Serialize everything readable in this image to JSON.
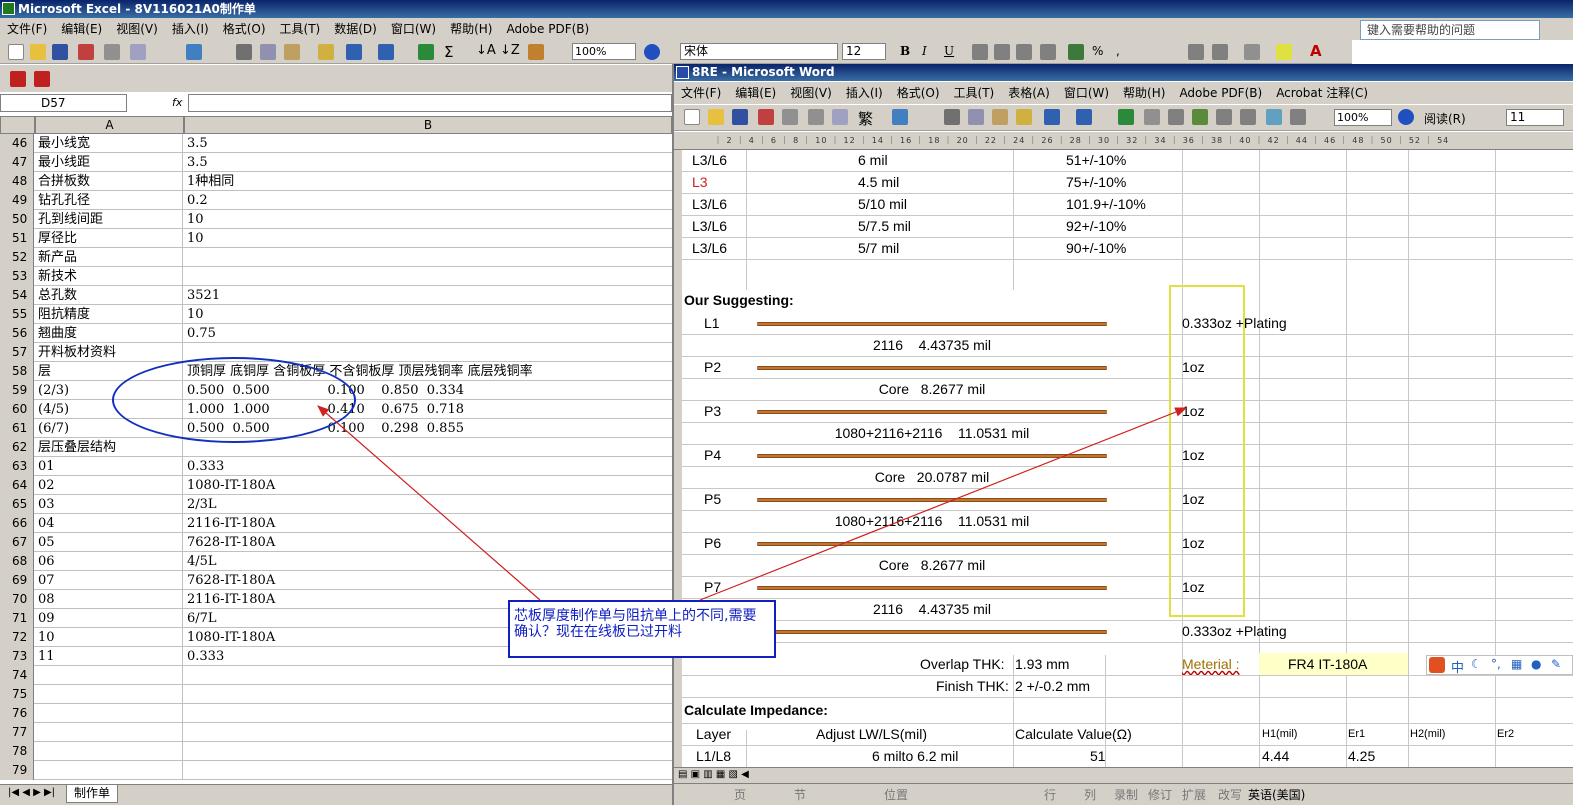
{
  "excel": {
    "title": "Microsoft Excel - 8V116021A0制作单",
    "menu": [
      "文件(F)",
      "编辑(E)",
      "视图(V)",
      "插入(I)",
      "格式(O)",
      "工具(T)",
      "数据(D)",
      "窗口(W)",
      "帮助(H)",
      "Adobe PDF(B)"
    ],
    "zoom": "100%",
    "font_name": "宋体",
    "font_size": "12",
    "help_placeholder": "键入需要帮助的问题",
    "name_box": "D57",
    "fx": "fx",
    "col_a": "A",
    "col_b": "B",
    "rows": [
      {
        "n": "46",
        "a": "最小线宽",
        "b": "3.5"
      },
      {
        "n": "47",
        "a": "最小线距",
        "b": "3.5"
      },
      {
        "n": "48",
        "a": "合拼板数",
        "b": "1种相同"
      },
      {
        "n": "49",
        "a": "钻孔孔径",
        "b": "0.2"
      },
      {
        "n": "50",
        "a": "孔到线间距",
        "b": "10"
      },
      {
        "n": "51",
        "a": "厚径比",
        "b": "10"
      },
      {
        "n": "52",
        "a": "新产品",
        "b": ""
      },
      {
        "n": "53",
        "a": "新技术",
        "b": ""
      },
      {
        "n": "54",
        "a": "总孔数",
        "b": "3521"
      },
      {
        "n": "55",
        "a": "阻抗精度",
        "b": "10"
      },
      {
        "n": "56",
        "a": "翘曲度",
        "b": "0.75"
      },
      {
        "n": "57",
        "a": "开料板材资料",
        "b": ""
      },
      {
        "n": "58",
        "a": "层",
        "b": "顶铜厚 底铜厚 含铜板厚 不含铜板厚 顶层残铜率 底层残铜率"
      },
      {
        "n": "59",
        "a": "(2/3)",
        "b": "0.500  0.500              0.100    0.850  0.334"
      },
      {
        "n": "60",
        "a": "(4/5)",
        "b": "1.000  1.000              0.410    0.675  0.718"
      },
      {
        "n": "61",
        "a": "(6/7)",
        "b": "0.500  0.500              0.100    0.298  0.855"
      },
      {
        "n": "62",
        "a": "层压叠层结构",
        "b": ""
      },
      {
        "n": "63",
        "a": "01",
        "b": "0.333"
      },
      {
        "n": "64",
        "a": "02",
        "b": "1080-IT-180A"
      },
      {
        "n": "65",
        "a": "03",
        "b": "2/3L"
      },
      {
        "n": "66",
        "a": "04",
        "b": "2116-IT-180A"
      },
      {
        "n": "67",
        "a": "05",
        "b": "7628-IT-180A"
      },
      {
        "n": "68",
        "a": "06",
        "b": "4/5L"
      },
      {
        "n": "69",
        "a": "07",
        "b": "7628-IT-180A"
      },
      {
        "n": "70",
        "a": "08",
        "b": "2116-IT-180A"
      },
      {
        "n": "71",
        "a": "09",
        "b": "6/7L"
      },
      {
        "n": "72",
        "a": "10",
        "b": "1080-IT-180A"
      },
      {
        "n": "73",
        "a": "11",
        "b": "0.333"
      },
      {
        "n": "74",
        "a": "",
        "b": ""
      },
      {
        "n": "75",
        "a": "",
        "b": ""
      },
      {
        "n": "76",
        "a": "",
        "b": ""
      },
      {
        "n": "77",
        "a": "",
        "b": ""
      },
      {
        "n": "78",
        "a": "",
        "b": ""
      },
      {
        "n": "79",
        "a": "",
        "b": ""
      }
    ],
    "sheet_tab": "制作单",
    "callout": "芯板厚度制作单与阻抗单上的不同,需要确认？现在在线板已过开料"
  },
  "word": {
    "title": "8RE - Microsoft Word",
    "menu": [
      "文件(F)",
      "编辑(E)",
      "视图(V)",
      "插入(I)",
      "格式(O)",
      "工具(T)",
      "表格(A)",
      "窗口(W)",
      "帮助(H)",
      "Adobe PDF(B)",
      "Acrobat 注释(C)"
    ],
    "zoom": "100%",
    "read_btn": "阅读(R)",
    "font_size": "11",
    "imp_rows": [
      {
        "layer": "L3/L6",
        "width": "6 mil",
        "value": "51+/-10%",
        "red": false
      },
      {
        "layer": "L3",
        "width": "4.5 mil",
        "value": "75+/-10%",
        "red": true
      },
      {
        "layer": "L3/L6",
        "width": "5/10 mil",
        "value": "101.9+/-10%",
        "red": false
      },
      {
        "layer": "L3/L6",
        "width": "5/7.5 mil",
        "value": "92+/-10%",
        "red": false
      },
      {
        "layer": "L3/L6",
        "width": "5/7 mil",
        "value": "90+/-10%",
        "red": false
      }
    ],
    "suggest_title": "Our Suggesting:",
    "stack": [
      {
        "label": "L1",
        "oz": "0.333oz +Plating",
        "copper": true
      },
      {
        "label": "",
        "text": "2116    4.43735 mil"
      },
      {
        "label": "P2",
        "oz": "1oz",
        "copper": true
      },
      {
        "label": "",
        "text": "Core   8.2677 mil"
      },
      {
        "label": "P3",
        "oz": "1oz",
        "copper": true
      },
      {
        "label": "",
        "text": "1080+2116+2116    11.0531 mil"
      },
      {
        "label": "P4",
        "oz": "1oz",
        "copper": true
      },
      {
        "label": "",
        "text": "Core   20.0787 mil"
      },
      {
        "label": "P5",
        "oz": "1oz",
        "copper": true
      },
      {
        "label": "",
        "text": "1080+2116+2116    11.0531 mil"
      },
      {
        "label": "P6",
        "oz": "1oz",
        "copper": true
      },
      {
        "label": "",
        "text": "Core   8.2677 mil"
      },
      {
        "label": "P7",
        "oz": "1oz",
        "copper": true
      },
      {
        "label": "",
        "text": "2116    4.43735 mil"
      },
      {
        "label": "",
        "oz": "0.333oz +Plating",
        "copper": true
      }
    ],
    "overlap_label": "Overlap THK:",
    "overlap_value": "1.93 mm",
    "material_label": "Meterial :",
    "material_value": "FR4 IT-180A",
    "finish_label": "Finish THK:",
    "finish_value": "2 +/-0.2 mm",
    "calc_title": "Calculate Impedance:",
    "calc_headers": [
      "Layer",
      "Adjust LW/LS(mil)",
      "Calculate Value(Ω)",
      "H1(mil)",
      "Er1",
      "H2(mil)",
      "Er2"
    ],
    "calc_row": [
      "L1/L8",
      "6 milto  6.2 mil",
      "51",
      "4.44",
      "4.25"
    ],
    "status": [
      "页",
      "节",
      "位置",
      "行",
      "列",
      "录制",
      "修订",
      "扩展",
      "改写",
      "英语(美国)"
    ]
  }
}
